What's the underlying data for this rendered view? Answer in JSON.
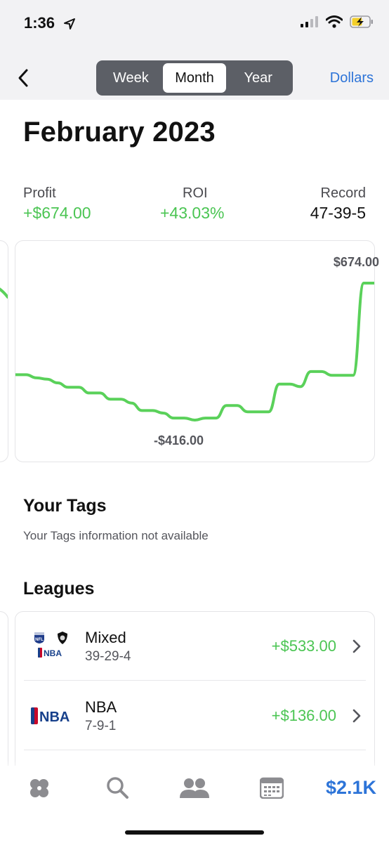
{
  "status_bar": {
    "time": "1:36"
  },
  "nav": {
    "segments": [
      "Week",
      "Month",
      "Year"
    ],
    "active_segment": "Month",
    "right_action": "Dollars"
  },
  "page_title": "February 2023",
  "stats": {
    "profit": {
      "label": "Profit",
      "value": "+$674.00"
    },
    "roi": {
      "label": "ROI",
      "value": "+43.03%"
    },
    "record": {
      "label": "Record",
      "value": "47-39-5"
    }
  },
  "chart_data": {
    "type": "line",
    "title": "",
    "xlabel": "",
    "ylabel": "",
    "max_label": "$674.00",
    "min_label": "-$416.00",
    "ylim": [
      -416,
      674
    ],
    "series": [
      {
        "color": "#5ad15a",
        "values": [
          -55,
          -55,
          -80,
          -90,
          -120,
          -155,
          -155,
          -200,
          -200,
          -250,
          -250,
          -280,
          -340,
          -340,
          -360,
          -400,
          -400,
          -416,
          -400,
          -400,
          -300,
          -300,
          -350,
          -350,
          -350,
          -130,
          -130,
          -150,
          -30,
          -30,
          -60,
          -60,
          -60,
          674,
          674
        ]
      }
    ],
    "grid": false,
    "legend": "none",
    "line_color": "#5ad15a"
  },
  "tags": {
    "title": "Your Tags",
    "empty_note": "Your Tags information not available"
  },
  "leagues": {
    "title": "Leagues",
    "items": [
      {
        "name": "Mixed",
        "record": "39-29-4",
        "profit": "+$533.00",
        "logos": [
          "nfl-logo",
          "nhl-logo",
          "nba-logo"
        ]
      },
      {
        "name": "NBA",
        "record": "7-9-1",
        "profit": "+$136.00",
        "logos": [
          "nba-logo"
        ]
      }
    ]
  },
  "tabbar": {
    "items": [
      "clover-icon",
      "search-icon",
      "people-icon",
      "calendar-icon"
    ],
    "balance": "$2.1K"
  },
  "colors": {
    "accent": "#2d74d8",
    "positive": "#4bc553",
    "chart_line": "#5ad15a"
  }
}
